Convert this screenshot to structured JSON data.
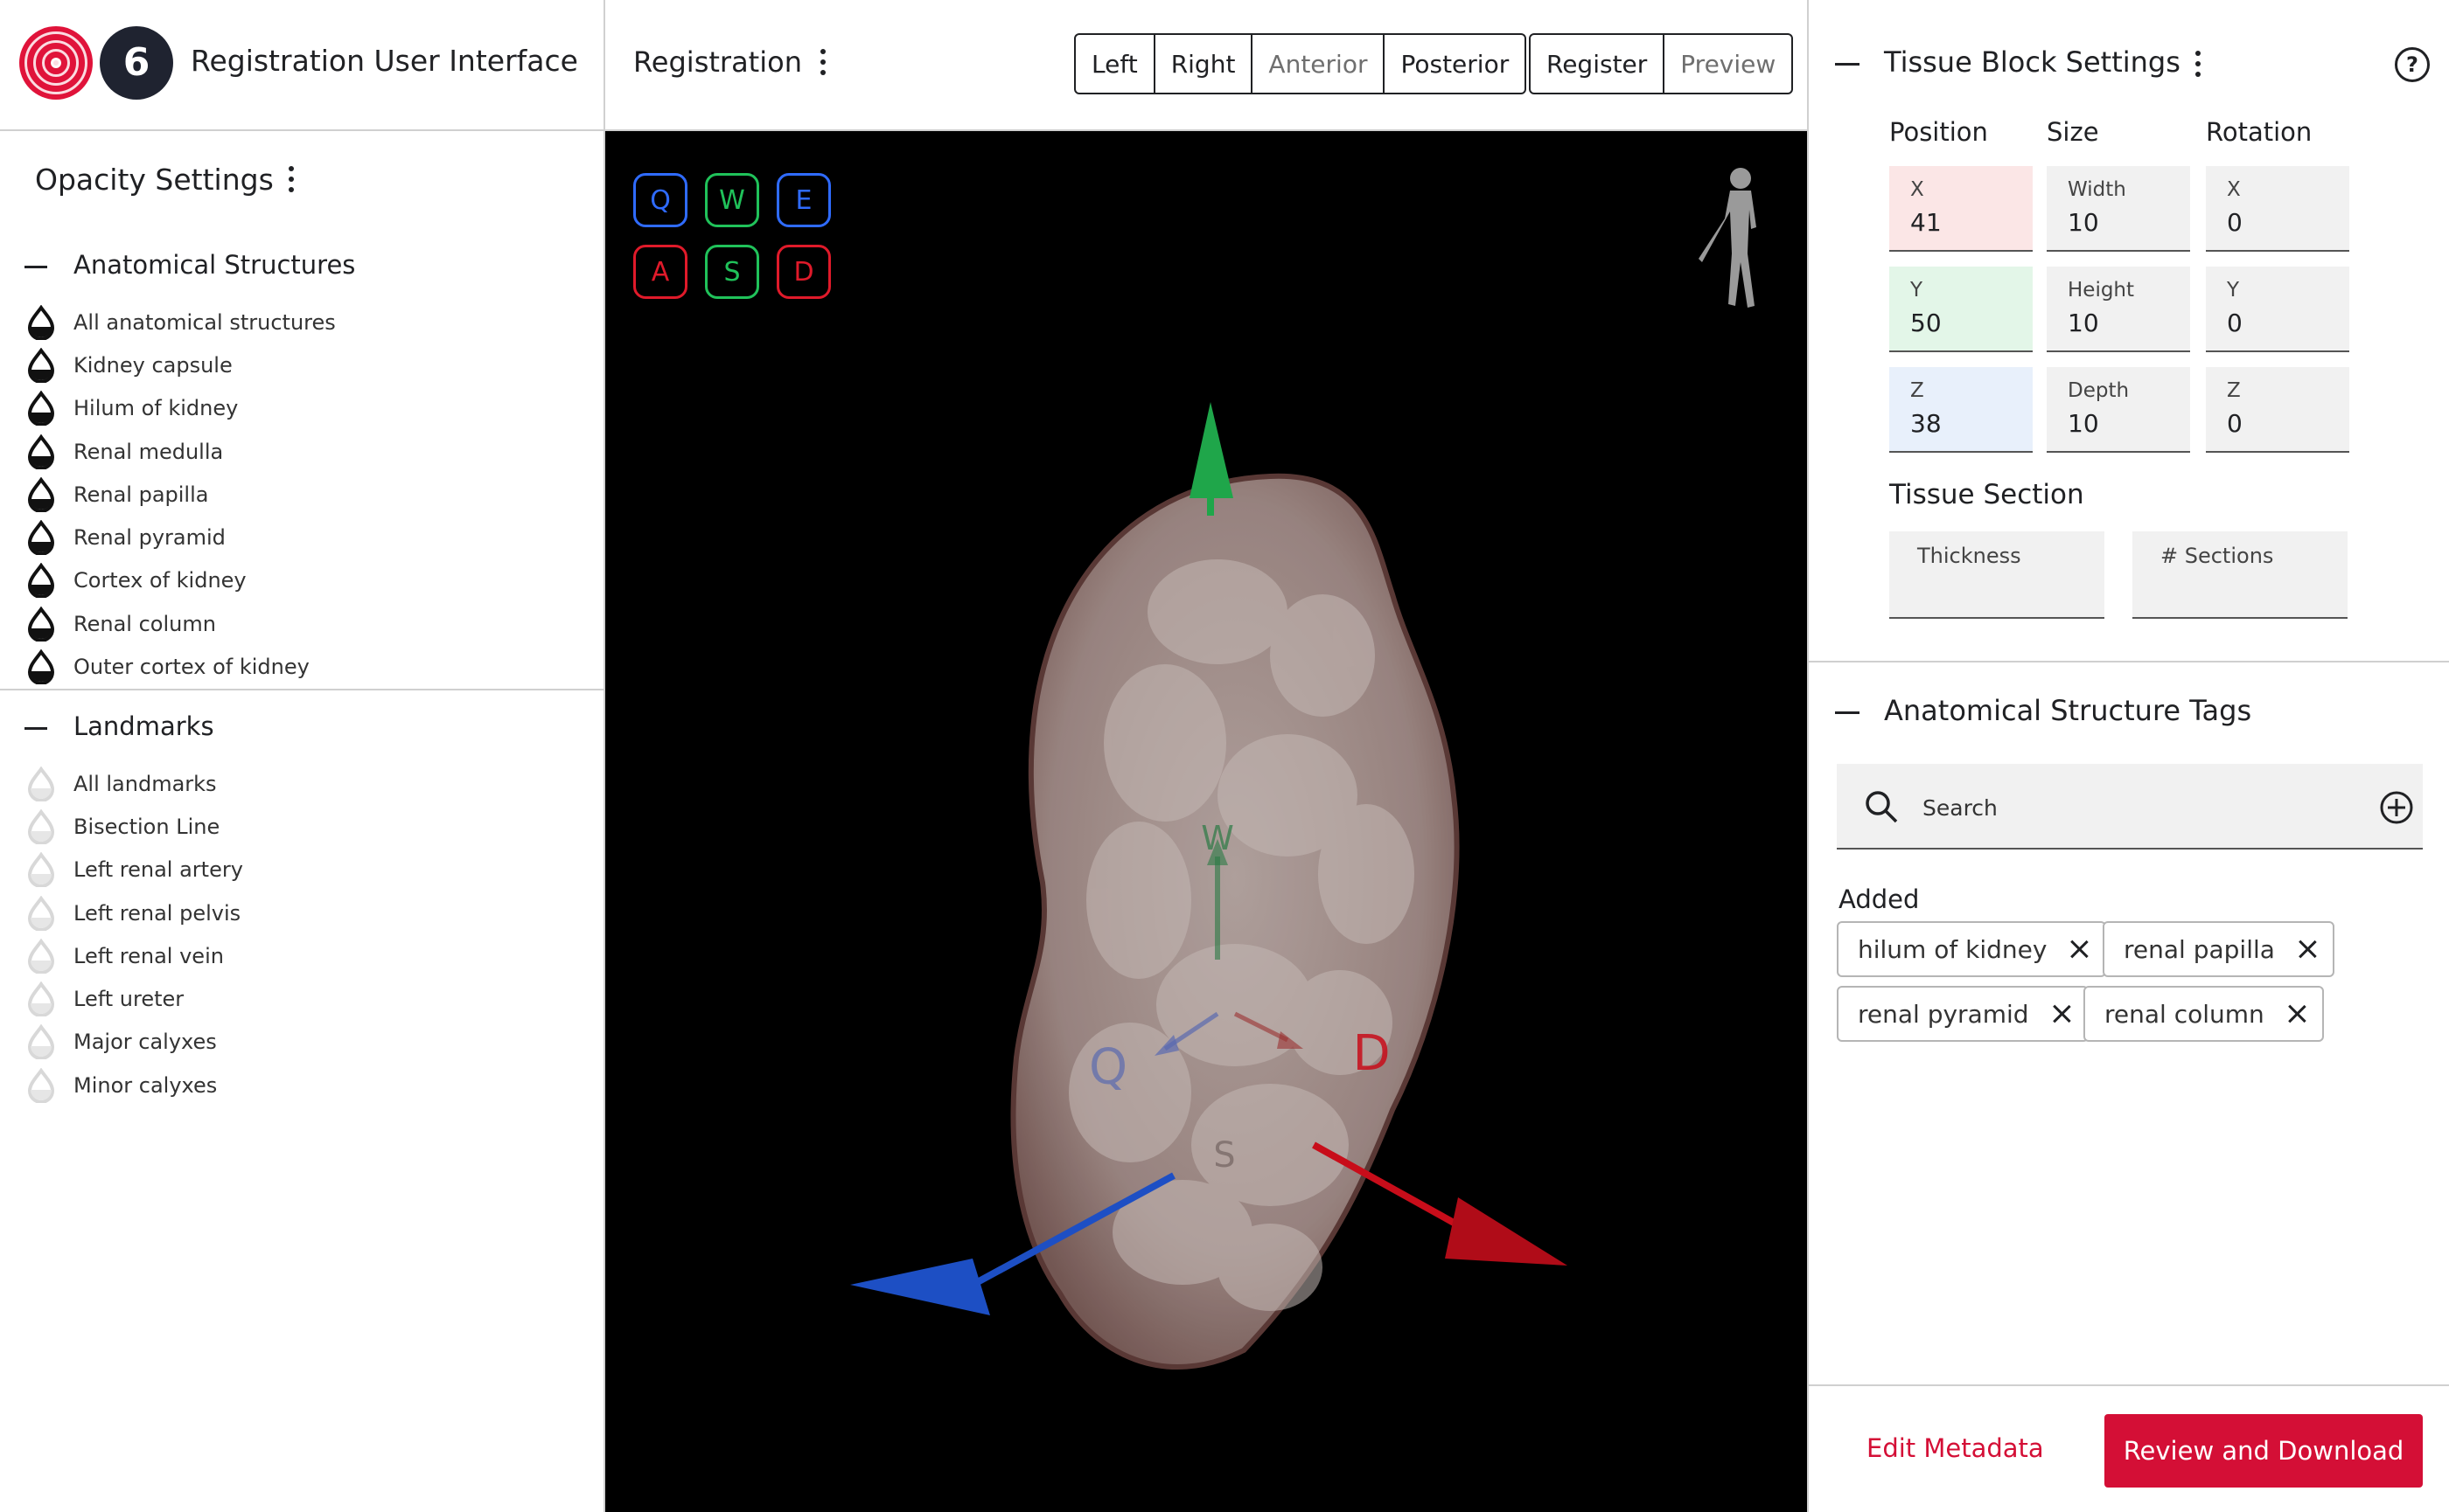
{
  "app": {
    "title": "Registration User Interface",
    "logo2_glyph": "6"
  },
  "opacity": {
    "title": "Opacity Settings",
    "anatomical": {
      "heading": "Anatomical Structures",
      "items": [
        "All anatomical structures",
        "Kidney capsule",
        "Hilum of kidney",
        "Renal medulla",
        "Renal papilla",
        "Renal pyramid",
        "Cortex of kidney",
        "Renal column",
        "Outer cortex of kidney"
      ],
      "state": "visible"
    },
    "landmarks": {
      "heading": "Landmarks",
      "items": [
        "All landmarks",
        "Bisection Line",
        "Left renal artery",
        "Left renal pelvis",
        "Left renal vein",
        "Left ureter",
        "Major calyxes",
        "Minor calyxes"
      ],
      "state": "hidden"
    }
  },
  "registration": {
    "title": "Registration",
    "views": [
      "Left",
      "Right",
      "Anterior",
      "Posterior"
    ],
    "actions": [
      "Register",
      "Preview"
    ],
    "keys": [
      {
        "label": "Q",
        "color": "#2f6bff"
      },
      {
        "label": "W",
        "color": "#20c25a"
      },
      {
        "label": "E",
        "color": "#2f6bff"
      },
      {
        "label": "A",
        "color": "#e01a2a"
      },
      {
        "label": "S",
        "color": "#20c25a"
      },
      {
        "label": "D",
        "color": "#e01a2a"
      }
    ],
    "gizmo_labels": {
      "w": "W",
      "q": "Q",
      "d": "D",
      "s": "S"
    }
  },
  "tissue_block": {
    "title": "Tissue Block Settings",
    "help_glyph": "?",
    "columns": {
      "position": "Position",
      "size": "Size",
      "rotation": "Rotation"
    },
    "position": {
      "x_label": "X",
      "x": "41",
      "y_label": "Y",
      "y": "50",
      "z_label": "Z",
      "z": "38"
    },
    "size": {
      "width_label": "Width",
      "width": "10",
      "height_label": "Height",
      "height": "10",
      "depth_label": "Depth",
      "depth": "10"
    },
    "rotation": {
      "x_label": "X",
      "x": "0",
      "y_label": "Y",
      "y": "0",
      "z_label": "Z",
      "z": "0"
    },
    "section": {
      "title": "Tissue Section",
      "thickness_label": "Thickness",
      "sections_label": "# Sections"
    }
  },
  "tags": {
    "title": "Anatomical Structure Tags",
    "search_placeholder": "Search",
    "added_label": "Added",
    "added": [
      "hilum of kidney",
      "renal papilla",
      "renal pyramid",
      "renal column"
    ]
  },
  "footer": {
    "edit_metadata": "Edit Metadata",
    "review_download": "Review and Download"
  },
  "colors": {
    "brand_red": "#d40f36",
    "axis_red": "#c80d1a",
    "axis_green": "#1fa64a",
    "axis_blue": "#1d4fc4"
  }
}
